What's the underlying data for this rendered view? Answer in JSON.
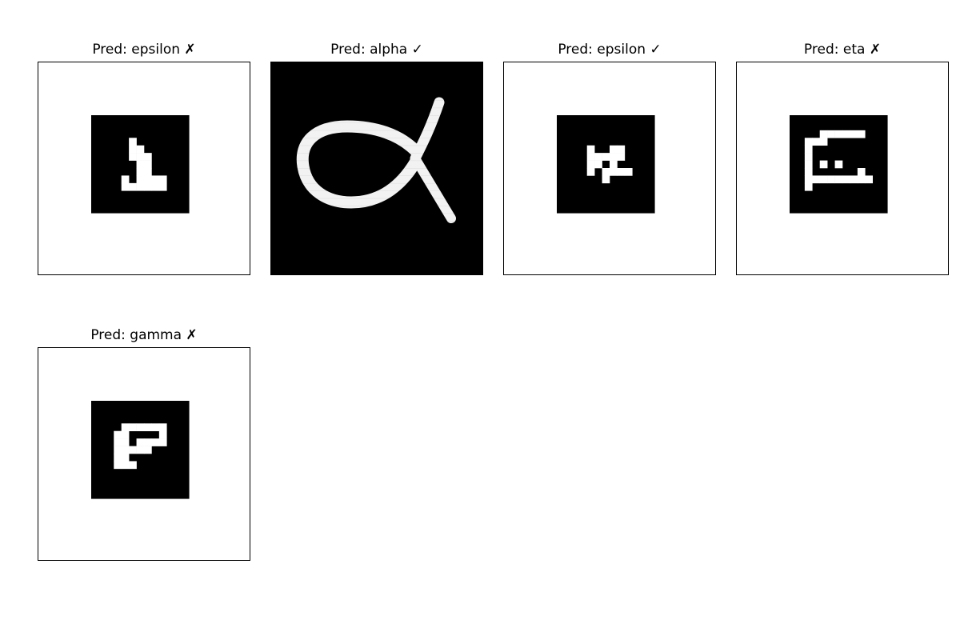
{
  "figure": {
    "panels": [
      {
        "title": "Pred: epsilon ✗",
        "label": "epsilon",
        "correct": false,
        "image": {
          "size": 28,
          "background": "#ffffff",
          "content": "small-glyph",
          "glyph_box": [
            7,
            7,
            13,
            13
          ],
          "glyph_rows": [
            "0000000000000",
            "0000000000000",
            "0000000000000",
            "0000010000000",
            "0000011000000",
            "0000011100000",
            "0000001100000",
            "0000001100000",
            "0000101111000",
            "0000111111000",
            "0000000000000",
            "0000000000000",
            "0000000000000"
          ]
        }
      },
      {
        "title": "Pred: alpha ✓",
        "label": "alpha",
        "correct": true,
        "image": {
          "size": 28,
          "background": "#000000",
          "content": "alpha-stroke"
        }
      },
      {
        "title": "Pred: epsilon ✓",
        "label": "epsilon",
        "correct": true,
        "image": {
          "size": 28,
          "background": "#ffffff",
          "content": "small-glyph",
          "glyph_box": [
            7,
            7,
            13,
            13
          ],
          "glyph_rows": [
            "0000000000000",
            "0000000000000",
            "0000000000000",
            "0000000000000",
            "0000100110000",
            "0000111110000",
            "0000110100000",
            "0000101111000",
            "0000001000000",
            "0000000000000",
            "0000000000000",
            "0000000000000",
            "0000000000000"
          ]
        }
      },
      {
        "title": "Pred: eta ✗",
        "label": "eta",
        "correct": false,
        "image": {
          "size": 28,
          "background": "#ffffff",
          "content": "small-glyph",
          "glyph_box": [
            7,
            7,
            13,
            13
          ],
          "glyph_rows": [
            "0000000000000",
            "0000000000000",
            "0000111111000",
            "0011100000000",
            "0010000000000",
            "0010000000000",
            "0010101000000",
            "0010000001000",
            "0011111111100",
            "0010000000000",
            "0000000000000",
            "0000000000000",
            "0000000000000"
          ]
        }
      },
      {
        "title": "Pred: gamma ✗",
        "label": "gamma",
        "correct": false,
        "image": {
          "size": 28,
          "background": "#ffffff",
          "content": "small-glyph",
          "glyph_box": [
            7,
            7,
            13,
            13
          ],
          "glyph_rows": [
            "0000000000000",
            "0000000000000",
            "0000000000000",
            "0000111111000",
            "0003100001000",
            "0003101111000",
            "0003111100000",
            "0003300000000",
            "0003330000000",
            "0000000000000",
            "0000000000000",
            "0000000000000",
            "0000000000000"
          ]
        }
      }
    ]
  }
}
